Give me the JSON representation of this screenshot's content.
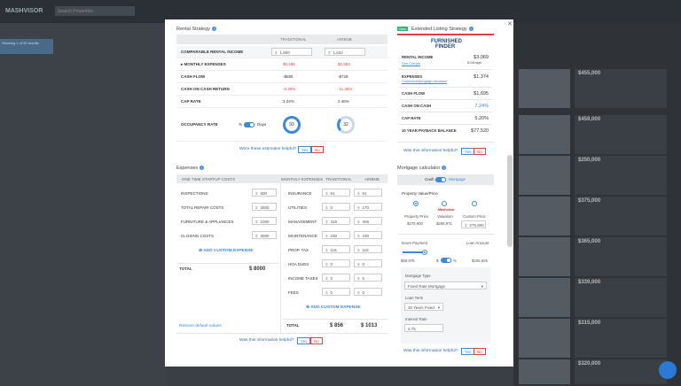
{
  "background": {
    "logo": "MASHVISOR",
    "search_placeholder": "Search Properties",
    "sidebar_badge": "Showing 1 of 50 results",
    "cards": [
      {
        "price": "$455,000"
      },
      {
        "price": "$459,000"
      },
      {
        "price": "$250,000"
      },
      {
        "price": "$375,000"
      },
      {
        "price": "$365,000"
      },
      {
        "price": "$339,000"
      },
      {
        "price": "$315,000"
      },
      {
        "price": "$320,000"
      }
    ]
  },
  "rental_strategy": {
    "title": "Rental Strategy",
    "col_traditional": "TRADITIONAL",
    "col_airbnb": "AIRBNB",
    "comparable_label": "COMPARABLE RENTAL INCOME",
    "comparable_traditional": "1,600",
    "comparable_airbnb": "1,624",
    "currency": "$",
    "rows": [
      {
        "label": "▸ MONTHLY EXPENSES",
        "traditional": "$2,195",
        "airbnb": "$2,353"
      },
      {
        "label": "CASH FLOW",
        "traditional": "-$595",
        "airbnb": "-$728"
      },
      {
        "label": "CASH ON CASH RETURN",
        "traditional": "-9.28%",
        "airbnb": "-11.35%"
      },
      {
        "label": "CAP RATE",
        "traditional": "3.24%",
        "airbnb": "2.46%"
      }
    ],
    "occupancy_label": "OCCUPANCY RATE",
    "occupancy_pct": "%",
    "occupancy_days": "Days",
    "occupancy_traditional": "93",
    "occupancy_airbnb": "32",
    "question": "Were these estimates helpful?",
    "yes": "Yes",
    "no": "No"
  },
  "expenses": {
    "title": "Expenses",
    "one_time_header": "ONE TIME STARTUP COSTS",
    "monthly_header": "MONTHLY EXPENSES",
    "col_traditional": "TRADITIONAL",
    "col_airbnb": "AIRBNB",
    "startup": [
      {
        "label": "INSPECTIONS",
        "value": "500"
      },
      {
        "label": "TOTAL REPAIR COSTS",
        "value": "2500"
      },
      {
        "label": "FURNITURE & APPLIANCES",
        "value": "1000"
      },
      {
        "label": "CLOSING COSTS",
        "value": "3000"
      }
    ],
    "add_custom": "ADD CUSTOM EXPENSE",
    "total_label": "TOTAL",
    "total_value": "$ 8000",
    "monthly": [
      {
        "label": "INSURANCE",
        "traditional": "91",
        "airbnb": "91"
      },
      {
        "label": "UTILITIES",
        "traditional": "0",
        "airbnb": "170"
      },
      {
        "label": "MANAGEMENT",
        "traditional": "419",
        "airbnb": "406"
      },
      {
        "label": "MAINTENANCE",
        "traditional": "230",
        "airbnb": "230"
      },
      {
        "label": "PROP. TAX",
        "traditional": "116",
        "airbnb": "116"
      },
      {
        "label": "HOA DUES",
        "traditional": "0",
        "airbnb": "0"
      },
      {
        "label": "INCOME TAXES",
        "traditional": "0",
        "airbnb": "0"
      },
      {
        "label": "FEES",
        "traditional": "0",
        "airbnb": "0"
      }
    ],
    "monthly_total_label": "TOTAL",
    "monthly_total_traditional": "$ 856",
    "monthly_total_airbnb": "$ 1013",
    "restore": "Restore default values",
    "question": "Was this information helpful?",
    "yes": "Yes",
    "no": "No"
  },
  "extended": {
    "badge": "New",
    "title": "Extended Listing Strategy",
    "brand": "FURNISHED FINDER",
    "rental_income_label": "RENTAL INCOME",
    "rental_income_value": "$3,069",
    "rental_income_sub": "$106/night",
    "see_comps": "See Comps",
    "expenses_label": "EXPENSES",
    "expenses_value": "$1,374",
    "customize": "Customize",
    "mortgage_calc": "Mortgage calculator",
    "cash_flow_label": "CASH FLOW",
    "cash_flow_value": "$1,695",
    "coc_label": "CASH ON CASH",
    "coc_value": "7.24%",
    "cap_label": "CAP RATE",
    "cap_value": "5.20%",
    "payback_label": "10 YEAR PAYBACK BALANCE",
    "payback_value": "$77,520",
    "question": "Was this information helpful?",
    "yes": "Yes",
    "no": "No"
  },
  "mortgage": {
    "title": "Mortgage calculator",
    "cash": "Cash",
    "mortgage": "Mortgage",
    "pv_label": "Property Value/Price",
    "opt1_label": "Property Price",
    "opt1_value": "$275,900",
    "opt2_brand": "Mashvisor",
    "opt2_label": "Valuation",
    "opt2_value": "$259,971",
    "opt3_label": "Custom Price",
    "opt3_value": "275,900",
    "down_label": "Down Payment",
    "loan_label": "Loan Amount",
    "down_value": "$58,975",
    "down_pct": "20",
    "pct": "%",
    "loan_value": "$206,925",
    "type_label": "Mortgage Type",
    "type_value": "Fixed Rate Mortgage",
    "term_label": "Loan Term",
    "term_value": "30 Years Fixed",
    "rate_label": "Interest Rate",
    "rate_value": "4.75",
    "question": "Was this information helpful?",
    "yes": "Yes",
    "no": "No"
  }
}
